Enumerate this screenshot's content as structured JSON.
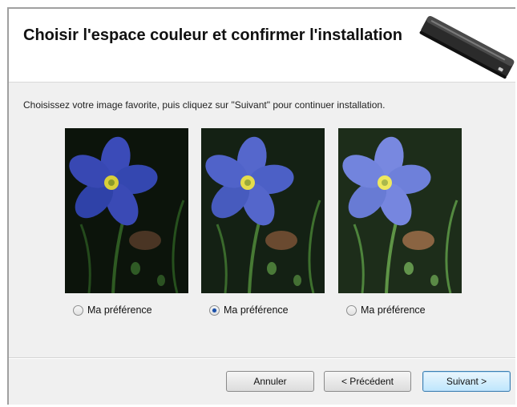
{
  "header": {
    "title": "Choisir l'espace couleur et confirmer l'installation"
  },
  "instruction": "Choisissez votre image favorite, puis cliquez sur \"Suivant\" pour continuer installation.",
  "options": [
    {
      "label": "Ma préférence",
      "selected": false
    },
    {
      "label": "Ma préférence",
      "selected": true
    },
    {
      "label": "Ma préférence",
      "selected": false
    }
  ],
  "buttons": {
    "cancel": "Annuler",
    "previous": "< Précédent",
    "next": "Suivant >"
  },
  "colors": {
    "flower": "#5a6fd8",
    "flower_center": "#e8e04a",
    "header_bg": "#ffffff",
    "dialog_bg": "#f0f0f0",
    "default_button": "#bee6fd"
  }
}
